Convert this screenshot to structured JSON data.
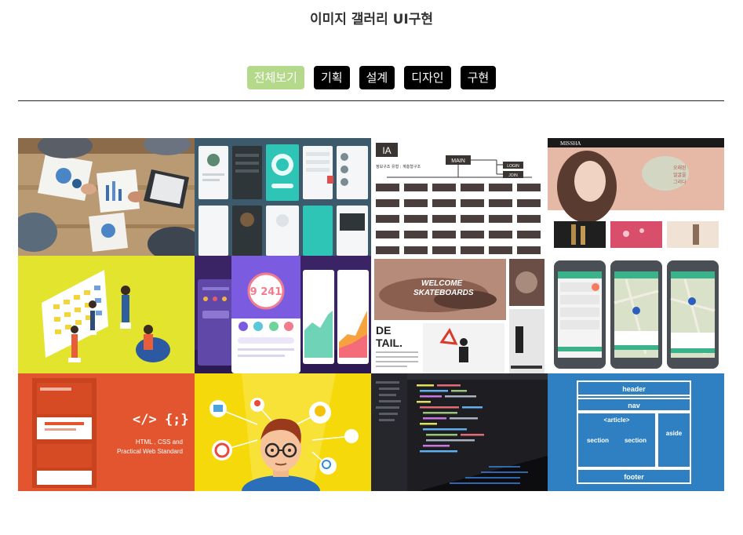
{
  "header": {
    "title": "이미지 갤러리 UI구현"
  },
  "filters": [
    {
      "label": "전체보기",
      "active": true
    },
    {
      "label": "기획",
      "active": false
    },
    {
      "label": "설계",
      "active": false
    },
    {
      "label": "디자인",
      "active": false
    },
    {
      "label": "구현",
      "active": false
    }
  ],
  "gallery": {
    "tiles": [
      {
        "name": "meeting-photo"
      },
      {
        "name": "mobile-app-screens"
      },
      {
        "name": "ia-sitemap"
      },
      {
        "name": "missha-website"
      },
      {
        "name": "planning-board-illustration"
      },
      {
        "name": "fitness-app-ui"
      },
      {
        "name": "skateboard-layout"
      },
      {
        "name": "map-app-mockups"
      },
      {
        "name": "html-css-book"
      },
      {
        "name": "idea-illustration"
      },
      {
        "name": "code-editor"
      },
      {
        "name": "html5-layout-diagram"
      }
    ],
    "texts": {
      "ia_label": "IA",
      "ia_main": "MAIN",
      "ia_login": "LOGIN",
      "ia_join": "JOIN",
      "ia_sub": "정보구조 유형 : 계층형구조",
      "missha_logo": "MISSHA",
      "missha_copy1": "오래된",
      "missha_copy2": "얼굴을",
      "missha_copy3": "그리다",
      "fitness_number": "9 241",
      "skate_title1": "WELCOME",
      "skate_title2": "SKATEBOARDS",
      "skate_detail1": "DE",
      "skate_detail2": "TAIL.",
      "book_symbol": "</> {;}",
      "book_line1": "HTML , CSS and",
      "book_line2": "Practical Web Standard",
      "layout_header": "header",
      "layout_nav": "nav",
      "layout_article": "<article>",
      "layout_section1": "section",
      "layout_section2": "section",
      "layout_aside": "aside",
      "layout_footer": "footer"
    }
  }
}
